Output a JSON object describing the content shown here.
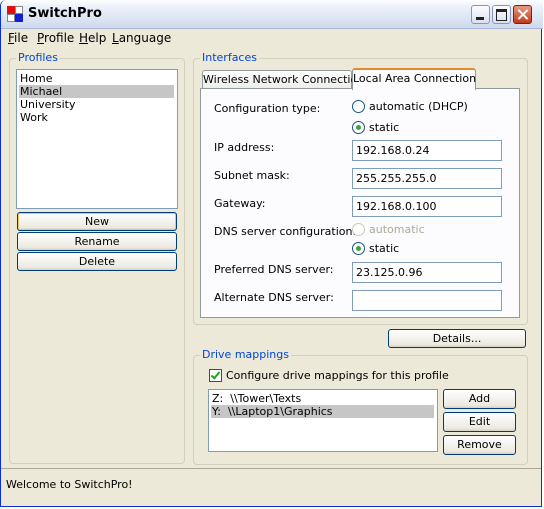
{
  "window": {
    "title": "SwitchPro"
  },
  "menu": [
    {
      "label": "File",
      "accel": "F",
      "rest": "ile"
    },
    {
      "label": "Profile",
      "accel": "P",
      "rest": "rofile"
    },
    {
      "label": "Help",
      "accel": "H",
      "rest": "elp"
    },
    {
      "label": "Language",
      "accel": "L",
      "rest": "anguage"
    }
  ],
  "profiles": {
    "label": "Profiles",
    "items": [
      "Home",
      "Michael",
      "University",
      "Work"
    ],
    "selected": "Michael",
    "new_button": "New",
    "rename_button": "Rename",
    "delete_button": "Delete"
  },
  "interfaces": {
    "label": "Interfaces",
    "tabs": [
      "Wireless Network Connection",
      "Local Area Connection"
    ],
    "active_tab": "Local Area Connection",
    "config_type_label": "Configuration type:",
    "config_auto": "automatic (DHCP)",
    "config_static": "static",
    "ip_label": "IP address:",
    "ip_value": "192.168.0.24",
    "subnet_label": "Subnet mask:",
    "subnet_value": "255.255.255.0",
    "gateway_label": "Gateway:",
    "gateway_value": "192.168.0.100",
    "dns_config_label": "DNS server configuration:",
    "dns_auto": "automatic",
    "dns_static": "static",
    "pref_dns_label": "Preferred DNS server:",
    "pref_dns_value": "23.125.0.96",
    "alt_dns_label": "Alternate DNS server:",
    "alt_dns_value": "",
    "details_button": "Details..."
  },
  "drives": {
    "label": "Drive mappings",
    "configure_checkbox": "Configure drive mappings for this profile",
    "configure_checked": true,
    "items": [
      {
        "letter": "Z:",
        "path": "\\\\Tower\\Texts"
      },
      {
        "letter": "Y:",
        "path": "\\\\Laptop1\\Graphics"
      }
    ],
    "add_button": "Add",
    "edit_button": "Edit",
    "remove_button": "Remove"
  },
  "status": {
    "text": "Welcome to SwitchPro!"
  }
}
